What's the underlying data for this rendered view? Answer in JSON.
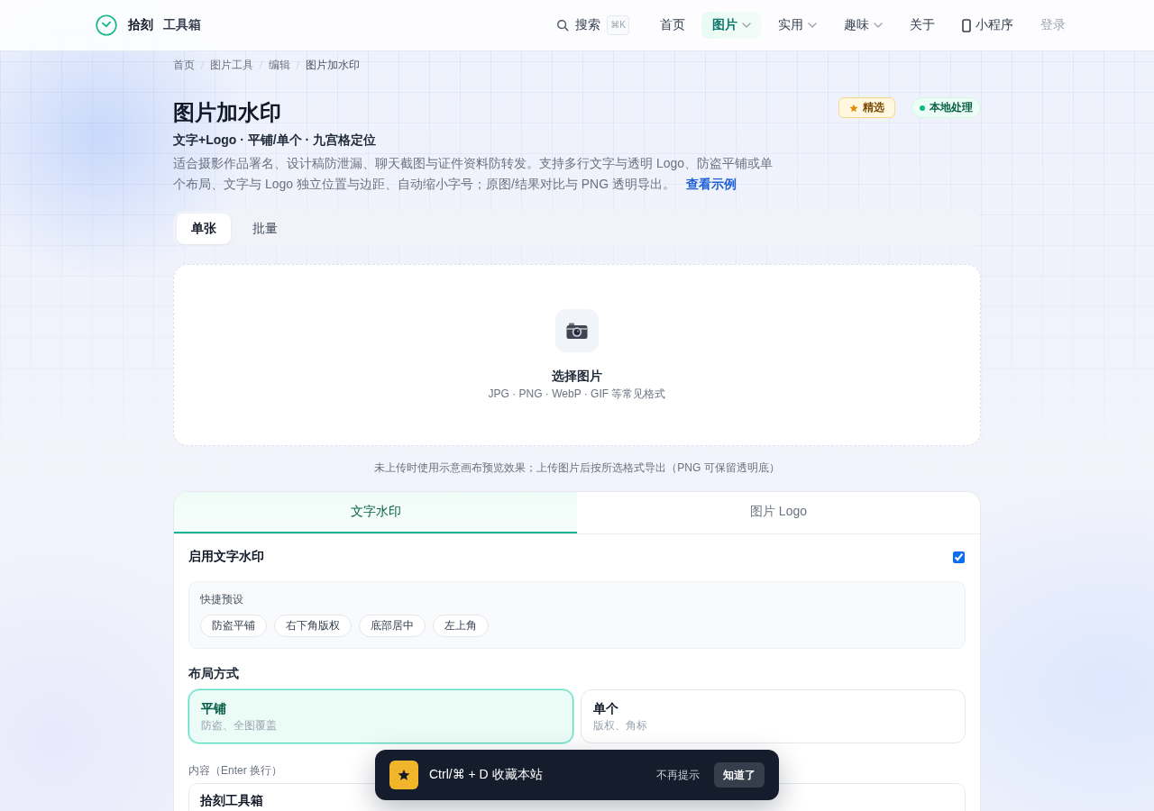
{
  "header": {
    "brand": {
      "name": "拾刻",
      "subtitle": "工具箱"
    },
    "search": {
      "label": "搜索",
      "shortcut": "⌘K"
    },
    "nav": [
      {
        "label": "首页",
        "kind": "link",
        "selected": false
      },
      {
        "label": "图片",
        "kind": "menu",
        "selected": true
      },
      {
        "label": "实用",
        "kind": "menu",
        "selected": false
      },
      {
        "label": "趣味",
        "kind": "menu",
        "selected": false
      },
      {
        "label": "关于",
        "kind": "link",
        "selected": false
      },
      {
        "label": "小程序",
        "kind": "app",
        "selected": false
      }
    ],
    "login": "登录"
  },
  "breadcrumb": [
    "首页",
    "图片工具",
    "编辑",
    "图片加水印"
  ],
  "intro": {
    "title": "图片加水印",
    "subtitle": "文字+Logo · 平铺/单个 · 九宫格定位",
    "description": "适合摄影作品署名、设计稿防泄漏、聊天截图与证件资料防转发。支持多行文字与透明 Logo、防盗平铺或单个布局、文字与 Logo 独立位置与边距、自动缩小字号；原图/结果对比与 PNG 透明导出。",
    "link": "查看示例",
    "badges": [
      {
        "kind": "featured",
        "label": "精选"
      },
      {
        "kind": "status",
        "label": "本地处理"
      }
    ]
  },
  "mode_tabs": [
    {
      "label": "单张",
      "selected": true
    },
    {
      "label": "批量",
      "selected": false
    }
  ],
  "upload": {
    "title": "选择图片",
    "hint": "JPG · PNG · WebP · GIF 等常见格式"
  },
  "note": "未上传时使用示意画布预览效果；上传图片后按所选格式导出（PNG 可保留透明底）",
  "panel": {
    "tabs": [
      {
        "label": "文字水印",
        "selected": true
      },
      {
        "label": "图片 Logo",
        "selected": false
      }
    ],
    "enable": {
      "label": "启用文字水印",
      "checked": true
    },
    "presets": {
      "label": "快捷预设",
      "items": [
        "防盗平铺",
        "右下角版权",
        "底部居中",
        "左上角"
      ]
    },
    "layout": {
      "label": "布局方式",
      "options": [
        {
          "title": "平铺",
          "subtitle": "防盗、全图覆盖",
          "selected": true
        },
        {
          "title": "单个",
          "subtitle": "版权、角标",
          "selected": false
        }
      ]
    },
    "content": {
      "label": "内容（Enter 换行）",
      "value": "拾刻工具箱"
    }
  },
  "toast": {
    "text": "Ctrl/⌘ + D 收藏本站",
    "dismiss": "不再提示",
    "confirm": "知道了"
  }
}
